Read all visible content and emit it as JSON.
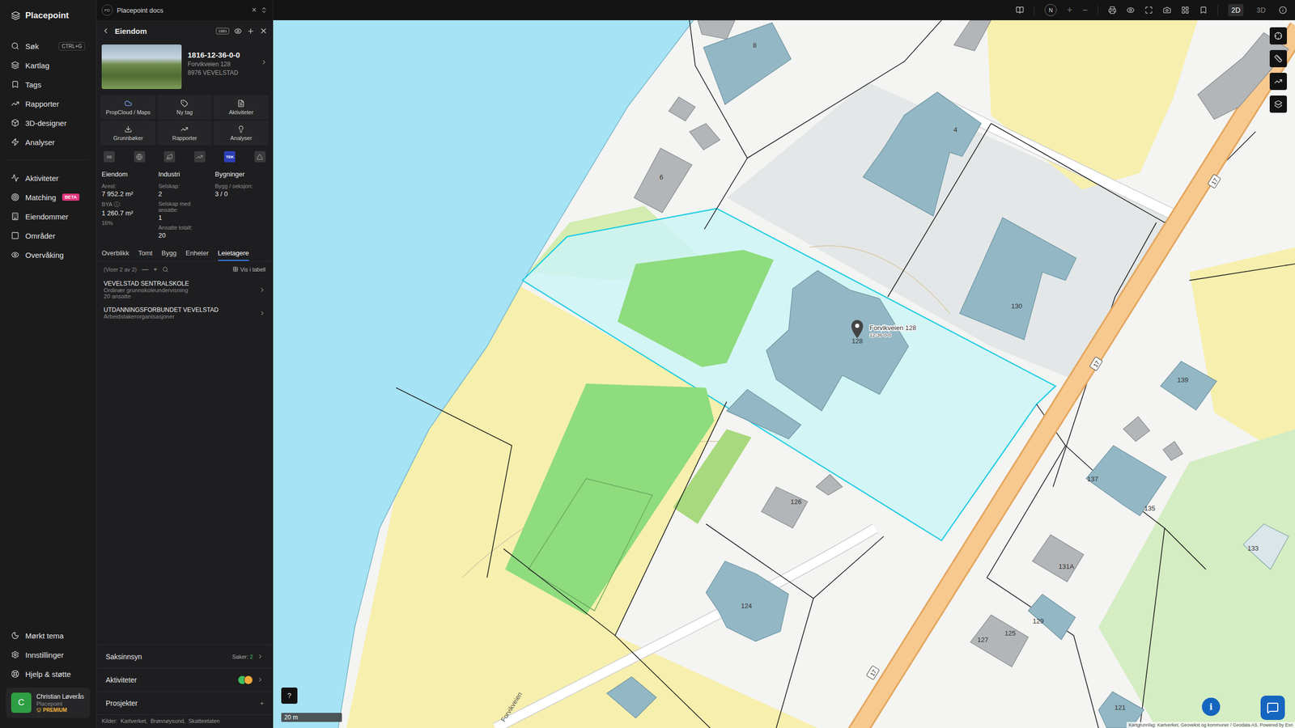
{
  "app": {
    "name": "Placepoint"
  },
  "doc_tab": {
    "badge": "PD",
    "title": "Placepoint docs",
    "close": "×"
  },
  "nav": {
    "primary": [
      {
        "label": "Søk",
        "shortcut": "CTRL+G"
      },
      {
        "label": "Kartlag"
      },
      {
        "label": "Tags"
      },
      {
        "label": "Rapporter"
      },
      {
        "label": "3D-designer"
      },
      {
        "label": "Analyser"
      }
    ],
    "secondary": [
      {
        "label": "Aktiviteter"
      },
      {
        "label": "Matching",
        "badge": "BETA"
      },
      {
        "label": "Eiendommer"
      },
      {
        "label": "Områder"
      },
      {
        "label": "Overvåking"
      }
    ],
    "bottom": [
      {
        "label": "Mørkt tema"
      },
      {
        "label": "Innstillinger"
      },
      {
        "label": "Hjelp & støtte"
      }
    ]
  },
  "user": {
    "initial": "C",
    "name": "Christian Løverås",
    "org": "Placepoint",
    "plan": "PREMIUM"
  },
  "panel": {
    "title": "Eiendom",
    "code_badge": "1881",
    "property": {
      "id": "1816-12-36-0-0",
      "address": "Forvikveien 128",
      "postal": "8976 VEVELSTAD"
    },
    "actions": [
      "PropCloud / Maps",
      "Ny tag",
      "Aktiviteter",
      "Grunnbøker",
      "Rapporter",
      "Analyser"
    ],
    "layers": [
      {
        "kind": "text",
        "label": "SE",
        "selected": false
      },
      {
        "kind": "icon",
        "selected": false
      },
      {
        "kind": "icon",
        "selected": false
      },
      {
        "kind": "icon",
        "selected": false
      },
      {
        "kind": "text",
        "label": "TEK",
        "selected": true
      },
      {
        "kind": "icon",
        "selected": false
      }
    ],
    "stats": [
      {
        "heading": "Eiendom",
        "rows": [
          {
            "label": "Areal:",
            "value": "7 952.2",
            "unit": "m²"
          },
          {
            "label": "BYA ⓘ:",
            "value": "1 260.7",
            "unit": "m²",
            "note": "16%"
          }
        ]
      },
      {
        "heading": "Industri",
        "rows": [
          {
            "label": "Selskap:",
            "value": "2"
          },
          {
            "label": "Selskap med ansatte:",
            "value": "1"
          },
          {
            "label": "Ansatte totalt:",
            "value": "20"
          }
        ]
      },
      {
        "heading": "Bygninger",
        "rows": [
          {
            "label": "Bygg / seksjon:",
            "value": "3 / 0"
          }
        ]
      }
    ],
    "tabs": [
      {
        "label": "Overblikk",
        "selected": false
      },
      {
        "label": "Tomt",
        "selected": false
      },
      {
        "label": "Bygg",
        "selected": false
      },
      {
        "label": "Enheter",
        "selected": false
      },
      {
        "label": "Leietagere",
        "selected": true
      }
    ],
    "list": {
      "count": "(Viser 2 av 2)",
      "collapse": "—",
      "add": "+",
      "table_toggle": "Vis i tabell"
    },
    "tenants": [
      {
        "name": "VEVELSTAD SENTRALSKOLE",
        "industry": "Ordinær grunnskoleundervisning",
        "employees": "20 ansatte"
      },
      {
        "name": "UTDANNINGSFORBUNDET VEVELSTAD",
        "industry": "Arbeidstakerorganisasjoner"
      }
    ],
    "sections": [
      {
        "title": "Saksinnsyn",
        "kind": "count",
        "meta_label": "Saker:",
        "meta_value": "2"
      },
      {
        "title": "Aktiviteter",
        "kind": "avatars"
      },
      {
        "title": "Prosjekter",
        "kind": "add",
        "action": "+"
      }
    ],
    "sources": {
      "label": "Kilder:",
      "items": [
        "Kartverket,",
        "Brønnøysund,",
        "Skatteetaten"
      ]
    }
  },
  "map": {
    "compass": "N",
    "zoom_in": "+",
    "zoom_out": "−",
    "view_modes": [
      {
        "label": "2D",
        "selected": true
      },
      {
        "label": "3D",
        "selected": false
      }
    ],
    "pin": {
      "number": "128",
      "title": "Forvikveien 128",
      "subtitle": "12-36-0-0"
    },
    "labels": [
      "8",
      "4",
      "6",
      "130",
      "126",
      "124",
      "139",
      "137",
      "135",
      "131A",
      "133",
      "129",
      "127",
      "125",
      "121"
    ],
    "road_label": "Forvikveien",
    "shields": [
      "17",
      "17",
      "17"
    ],
    "scale": "20 m",
    "help": "?",
    "info": "i",
    "attribution": "Kartgrunnlag: Kartverket, Geovekst og kommuner / Geodata AS. Powered by Esri"
  }
}
